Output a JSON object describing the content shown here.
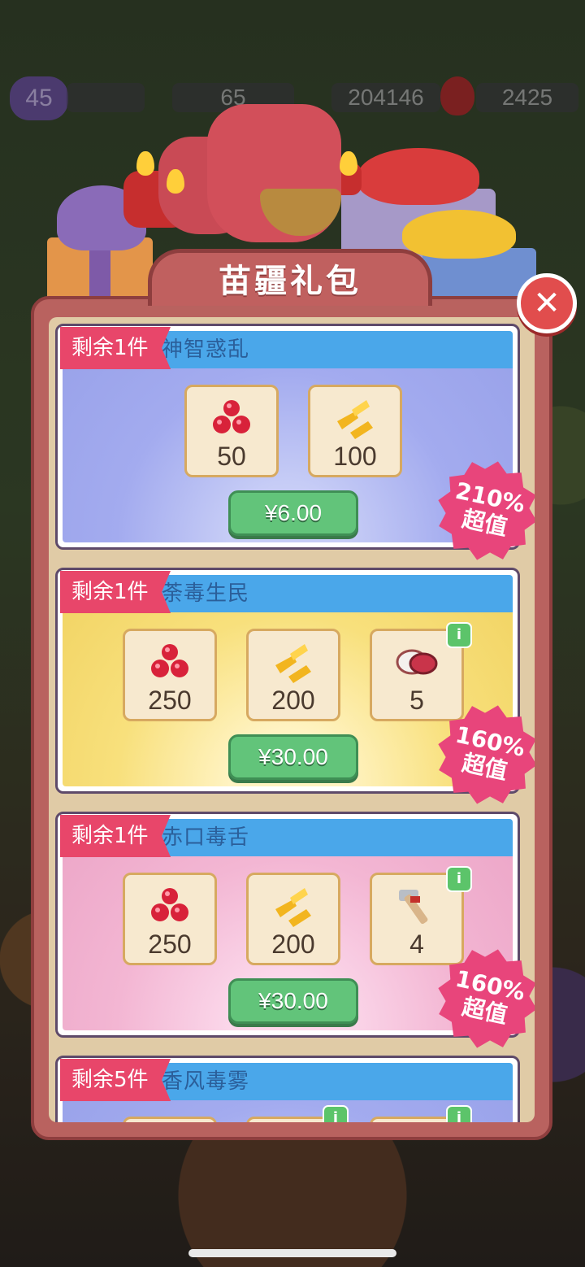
{
  "topbar": {
    "level": "45",
    "energy": "65",
    "coins": "204146",
    "gems": "2425"
  },
  "dialog": {
    "title": "苗疆礼包",
    "close_icon": "close-icon"
  },
  "packs": [
    {
      "remaining": "剩余1件",
      "name": "神智惑乱",
      "theme": "purple",
      "items": [
        {
          "icon": "ruby-gems-icon",
          "qty": "50"
        },
        {
          "icon": "gold-bars-icon",
          "qty": "100"
        }
      ],
      "price": "¥6.00",
      "value_percent": "210%",
      "value_label": "超值"
    },
    {
      "remaining": "剩余1件",
      "name": "荼毒生民",
      "theme": "yellow",
      "items": [
        {
          "icon": "ruby-gems-icon",
          "qty": "250"
        },
        {
          "icon": "gold-bars-icon",
          "qty": "200"
        },
        {
          "icon": "gloves-icon",
          "qty": "5",
          "info": true
        }
      ],
      "price": "¥30.00",
      "value_percent": "160%",
      "value_label": "超值"
    },
    {
      "remaining": "剩余1件",
      "name": "赤口毒舌",
      "theme": "pink",
      "items": [
        {
          "icon": "ruby-gems-icon",
          "qty": "250"
        },
        {
          "icon": "gold-bars-icon",
          "qty": "200"
        },
        {
          "icon": "hammer-icon",
          "qty": "4",
          "info": true
        }
      ],
      "price": "¥30.00",
      "value_percent": "160%",
      "value_label": "超值"
    },
    {
      "remaining": "剩余5件",
      "name": "香风毒雾",
      "theme": "purple"
    }
  ],
  "colors": {
    "panel": "#b9625f",
    "panel_border": "#8e3e3e",
    "header_blue": "#4aa7ea",
    "ribbon": "#e8466a",
    "price_button": "#62c47a",
    "burst": "#e8457b"
  }
}
